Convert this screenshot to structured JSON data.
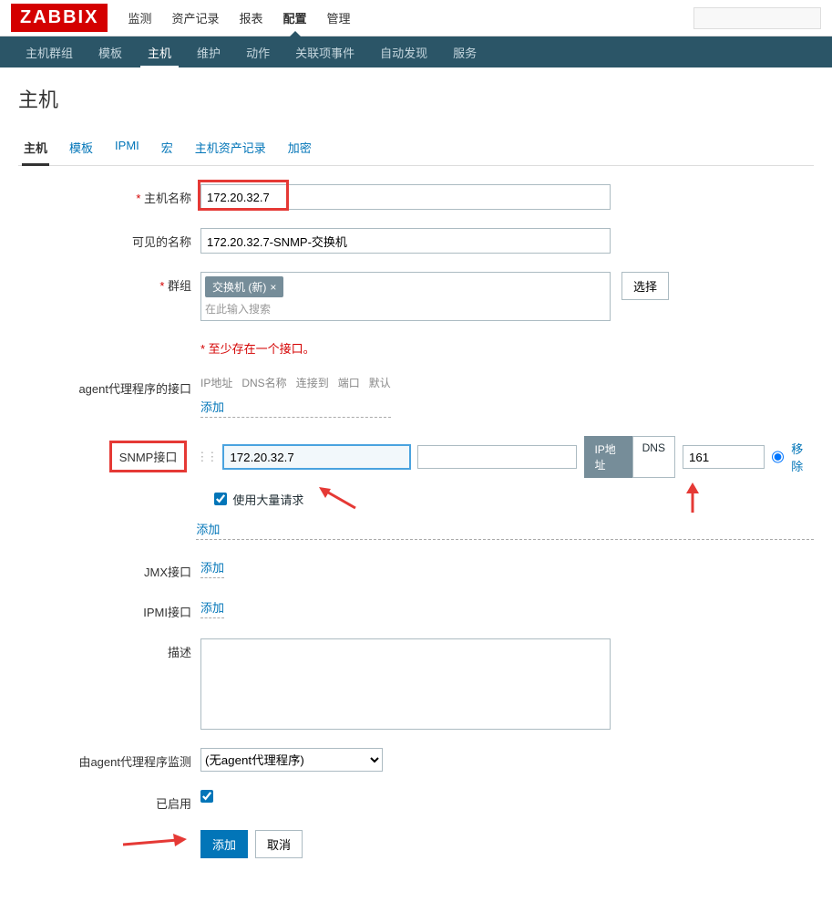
{
  "logo": "ZABBIX",
  "topnav": [
    "监测",
    "资产记录",
    "报表",
    "配置",
    "管理"
  ],
  "topnav_active": 3,
  "subnav": [
    "主机群组",
    "模板",
    "主机",
    "维护",
    "动作",
    "关联项事件",
    "自动发现",
    "服务"
  ],
  "subnav_active": 2,
  "page_title": "主机",
  "tabs": [
    "主机",
    "模板",
    "IPMI",
    "宏",
    "主机资产记录",
    "加密"
  ],
  "tab_active": 0,
  "form": {
    "host_name_label": "主机名称",
    "host_name_value": "172.20.32.7",
    "visible_name_label": "可见的名称",
    "visible_name_value": "172.20.32.7-SNMP-交换机",
    "groups_label": "群组",
    "group_tag": "交换机 (新)",
    "group_placeholder": "在此输入搜索",
    "select_btn": "选择",
    "iface_note": "至少存在一个接口。",
    "agent_iface_label": "agent代理程序的接口",
    "iface_headers": [
      "IP地址",
      "DNS名称",
      "连接到",
      "端口",
      "默认"
    ],
    "add_link": "添加",
    "snmp_label": "SNMP接口",
    "snmp_ip": "172.20.32.7",
    "snmp_port": "161",
    "connect_ip": "IP地址",
    "connect_dns": "DNS",
    "bulk_label": "使用大量请求",
    "remove_link": "移除",
    "jmx_label": "JMX接口",
    "ipmi_label": "IPMI接口",
    "desc_label": "描述",
    "proxy_label": "由agent代理程序监测",
    "proxy_value": "(无agent代理程序)",
    "enabled_label": "已启用",
    "submit": "添加",
    "cancel": "取消"
  }
}
